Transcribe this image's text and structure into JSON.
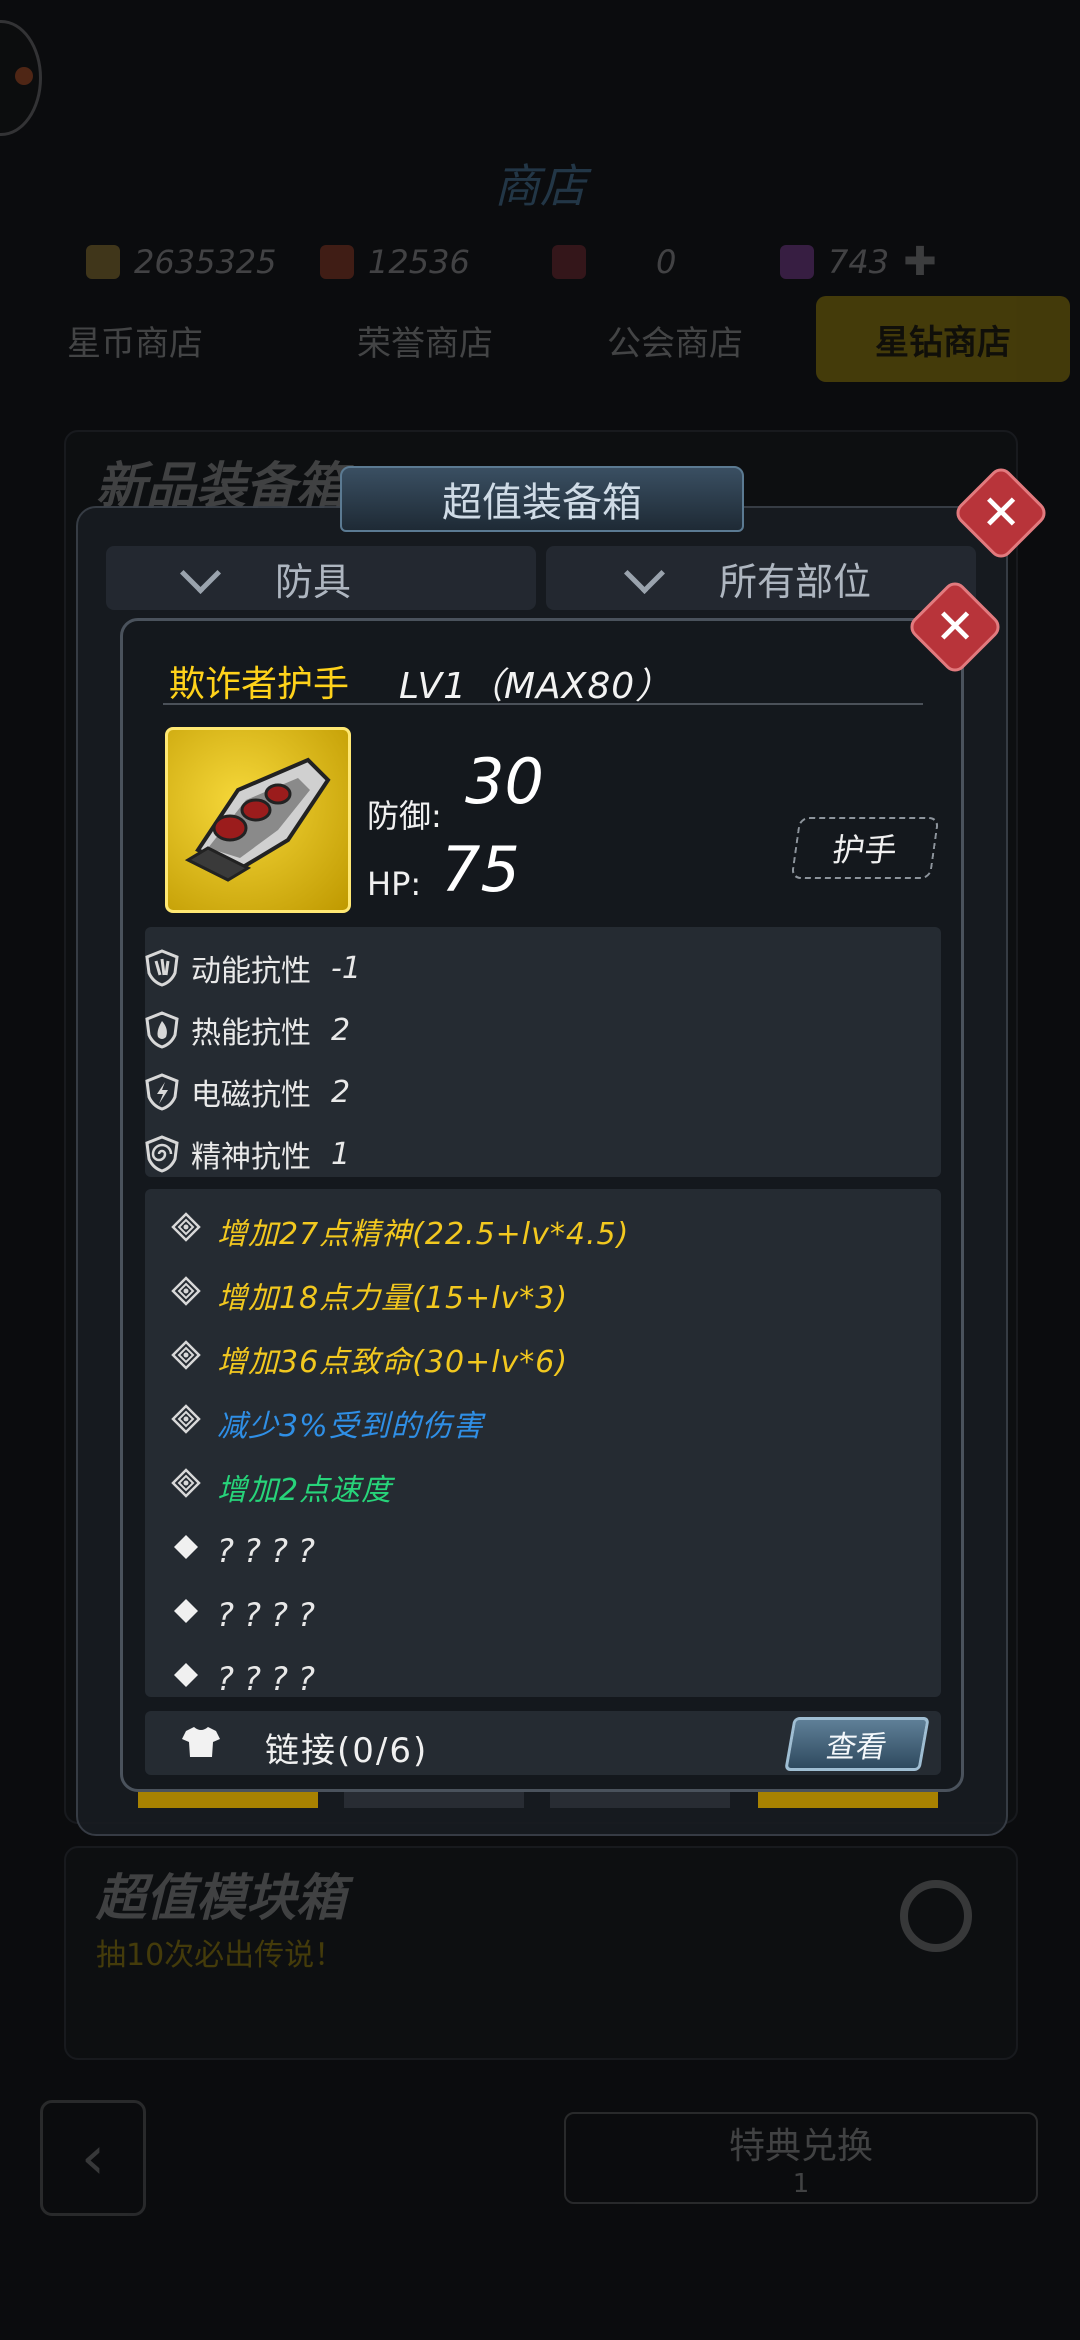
{
  "background_shop": {
    "title": "商店",
    "currencies": [
      {
        "icon": "gold-coin-icon",
        "value": "2635325"
      },
      {
        "icon": "badge-icon",
        "value": "12536"
      },
      {
        "icon": "token-icon",
        "value": "0"
      },
      {
        "icon": "star-diamond-icon",
        "value": "743"
      }
    ],
    "tabs": [
      "星币商店",
      "荣誉商店",
      "公会商店",
      "星钻商店"
    ],
    "active_tab": "星钻商店",
    "box1_title": "新品装备箱",
    "box2_title": "超值模块箱",
    "box2_note": "抽10次必出传说！",
    "exchange_label": "特典兑换",
    "exchange_count": "1"
  },
  "box_dialog": {
    "title": "超值装备箱",
    "filter_type": "防具",
    "filter_slot": "所有部位"
  },
  "item": {
    "name": "欺诈者护手",
    "level": "LV1（MAX80）",
    "defense_label": "防御:",
    "defense_value": "30",
    "hp_label": "HP:",
    "hp_value": "75",
    "slot": "护手",
    "resistances": [
      {
        "icon": "kinetic-shield-icon",
        "name": "动能抗性",
        "value": "-1"
      },
      {
        "icon": "fire-shield-icon",
        "name": "热能抗性",
        "value": "2"
      },
      {
        "icon": "lightning-shield-icon",
        "name": "电磁抗性",
        "value": "2"
      },
      {
        "icon": "spiral-shield-icon",
        "name": "精神抗性",
        "value": "1"
      }
    ],
    "attributes": [
      {
        "text": "增加27点精神(22.5+lv*4.5)",
        "color": "#f2c81f"
      },
      {
        "text": "增加18点力量(15+lv*3)",
        "color": "#f2c81f"
      },
      {
        "text": "增加36点致命(30+lv*6)",
        "color": "#f2c81f"
      },
      {
        "text": "减少3%受到的伤害",
        "color": "#2f8fe6"
      },
      {
        "text": "增加2点速度",
        "color": "#27d47a"
      },
      {
        "text": "????",
        "color": "#e8e8e8"
      },
      {
        "text": "????",
        "color": "#e8e8e8"
      },
      {
        "text": "????",
        "color": "#e8e8e8"
      }
    ],
    "link_text": "链接(0/6)",
    "view_label": "查看"
  },
  "colors": {
    "accent_yellow": "#ffd21a",
    "close_red": "#b8343a",
    "panel": "#252b32"
  }
}
